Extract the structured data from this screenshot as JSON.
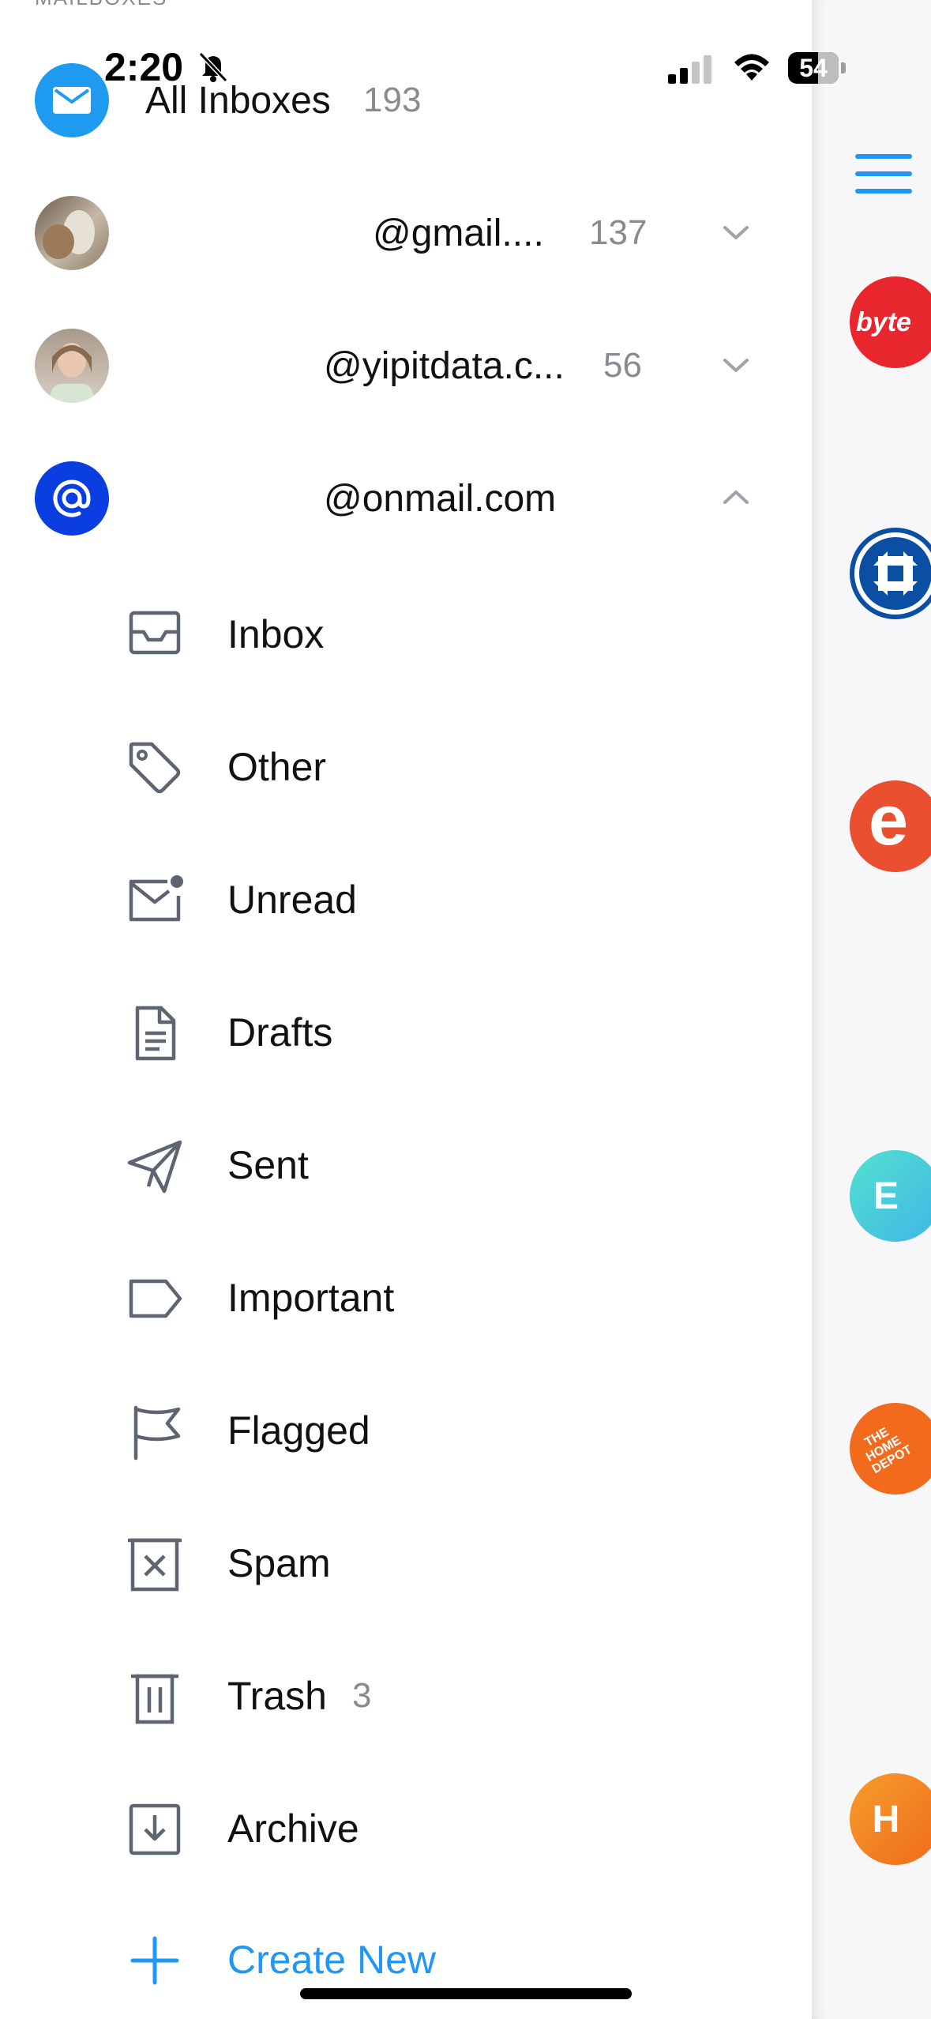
{
  "status": {
    "time": "2:20",
    "battery": "54"
  },
  "section_caption": "MAILBOXES",
  "accounts": [
    {
      "label": "All Inboxes",
      "count": "193"
    },
    {
      "label": "@gmail....",
      "count": "137"
    },
    {
      "label": "@yipitdata.c...",
      "count": "56"
    },
    {
      "label": "@onmail.com",
      "count": ""
    }
  ],
  "folders": [
    {
      "label": "Inbox",
      "icon": "inbox-icon",
      "count": ""
    },
    {
      "label": "Other",
      "icon": "tag-icon",
      "count": ""
    },
    {
      "label": "Unread",
      "icon": "unread-mail-icon",
      "count": ""
    },
    {
      "label": "Drafts",
      "icon": "document-icon",
      "count": ""
    },
    {
      "label": "Sent",
      "icon": "paper-plane-icon",
      "count": ""
    },
    {
      "label": "Important",
      "icon": "label-icon",
      "count": ""
    },
    {
      "label": "Flagged",
      "icon": "flag-icon",
      "count": ""
    },
    {
      "label": "Spam",
      "icon": "spam-box-icon",
      "count": ""
    },
    {
      "label": "Trash",
      "icon": "trash-icon",
      "count": "3"
    },
    {
      "label": "Archive",
      "icon": "archive-icon",
      "count": ""
    }
  ],
  "create_new": {
    "label": "Create New"
  },
  "peek_avatars": [
    {
      "text": "byte",
      "color": "#e8262e"
    },
    {
      "text": "",
      "color": "#0b4fa3"
    },
    {
      "text": "e",
      "color": "#ea4f2f"
    },
    {
      "text": "E",
      "color": "#35c9c9"
    },
    {
      "text": "THE HOME DEPOT",
      "color": "#f26a1b"
    },
    {
      "text": "H",
      "color": "#f47b20"
    }
  ],
  "colors": {
    "accent": "#2196f3",
    "icon": "#5f6570",
    "muted": "#8a8a8f"
  }
}
